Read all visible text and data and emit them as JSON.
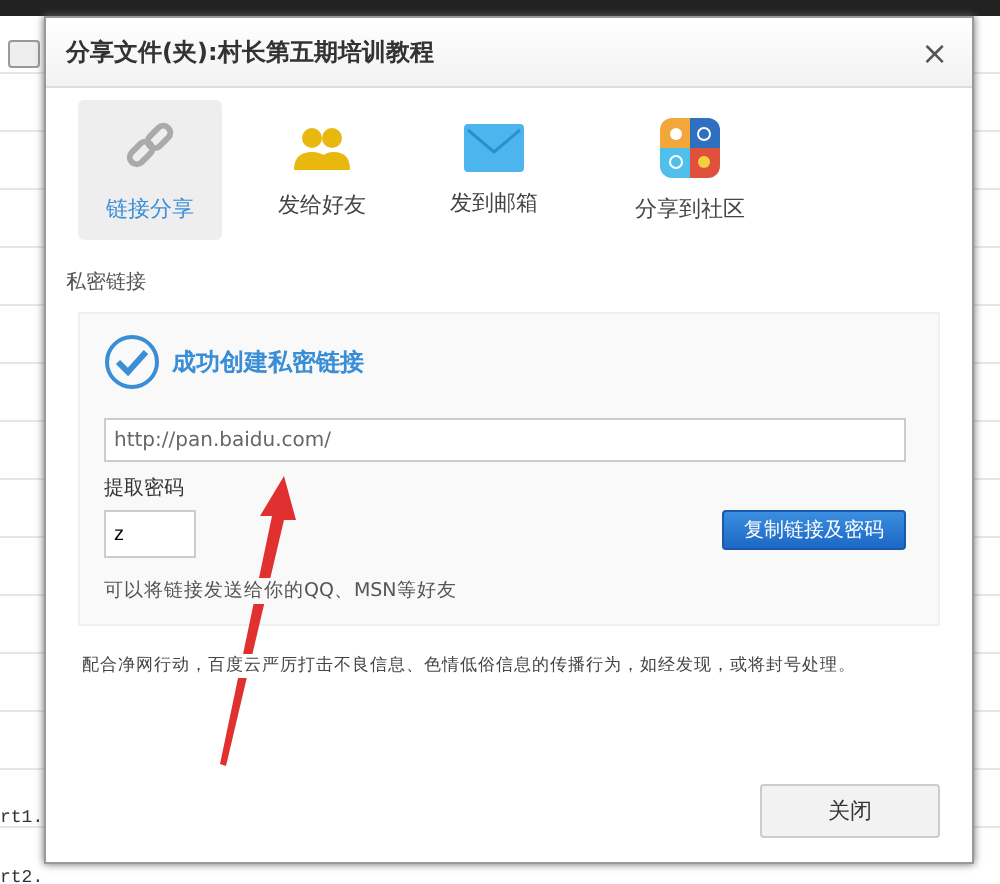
{
  "background": {
    "rows": [
      {
        "text": "rt1."
      },
      {
        "text": "rt2."
      }
    ]
  },
  "dialog": {
    "title": "分享文件(夹):村长第五期培训教程",
    "close_icon": "×",
    "tabs": [
      {
        "label": "链接分享",
        "selected": true
      },
      {
        "label": "发给好友",
        "selected": false
      },
      {
        "label": "发到邮箱",
        "selected": false
      },
      {
        "label": "分享到社区",
        "selected": false
      }
    ],
    "section_label": "私密链接",
    "success_message": "成功创建私密链接",
    "link_field": {
      "value": "http://pan.baidu.com/"
    },
    "password_label": "提取密码",
    "password_field": {
      "value": "z"
    },
    "copy_button": "复制链接及密码",
    "hint": "可以将链接发送给你的QQ、MSN等好友",
    "notice": "配合净网行动，百度云严厉打击不良信息、色情低俗信息的传播行为，如经发现，或将封号处理。",
    "close_button": "关闭"
  },
  "annotation": {
    "kind": "arrow"
  }
}
